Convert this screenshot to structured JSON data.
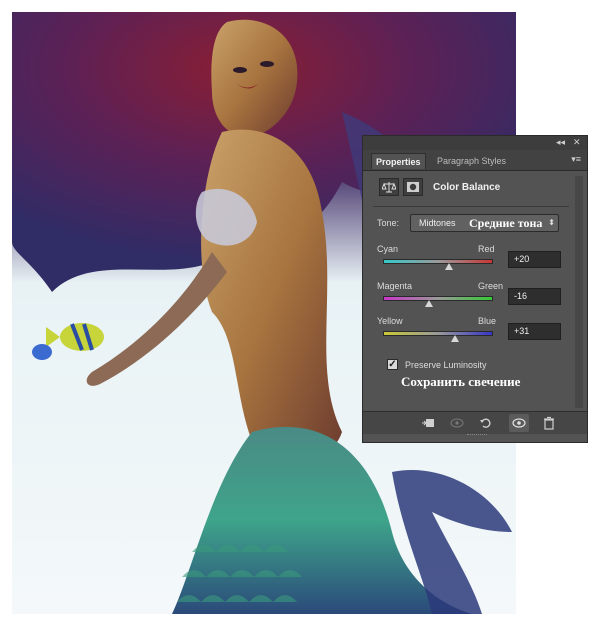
{
  "panel": {
    "collapse_glyph": "◂◂",
    "close_glyph": "✕",
    "tabs": [
      {
        "label": "Properties",
        "active": true
      },
      {
        "label": "Paragraph Styles",
        "active": false
      }
    ],
    "title": "Color Balance",
    "tone_label": "Tone:",
    "tone_value": "Midtones",
    "tone_value_ru": "Средние тона",
    "sliders": [
      {
        "left_label": "Cyan",
        "right_label": "Red",
        "value": "+20",
        "level": 20,
        "gradient": [
          "#36c9c9",
          "#c93636"
        ]
      },
      {
        "left_label": "Magenta",
        "right_label": "Green",
        "value": "-16",
        "level": -16,
        "gradient": [
          "#c936c9",
          "#36c936"
        ]
      },
      {
        "left_label": "Yellow",
        "right_label": "Blue",
        "value": "+31",
        "level": 31,
        "gradient": [
          "#c9c936",
          "#3636c9"
        ]
      }
    ],
    "preserve_luminosity": "Preserve Luminosity",
    "preserve_luminosity_ru": "Сохранить свечение",
    "preserve_checked": true,
    "bottom_icons": [
      "clip-to-layer-icon",
      "toggle-visibility-preview-icon",
      "reset-icon",
      "eye-icon",
      "trash-icon"
    ]
  },
  "colors": {
    "panel_bg": "#535353",
    "accent_hair": "#7a1a2c",
    "tail": "#3c7f78"
  }
}
